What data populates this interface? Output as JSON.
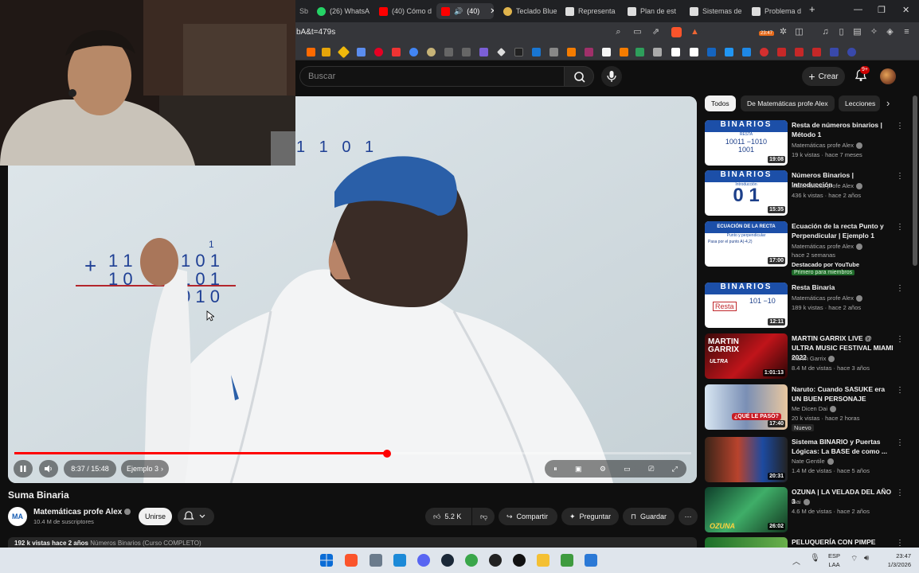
{
  "browser": {
    "tabs": [
      {
        "label": "(26) WhatsA",
        "icon": "whatsapp-icon",
        "color": "#25d366"
      },
      {
        "label": "(40) Cómo d",
        "icon": "youtube-icon",
        "color": "#ff0000"
      },
      {
        "label": "(40)",
        "icon": "youtube-icon",
        "color": "#ff0000",
        "active": true
      },
      {
        "label": "Teclado Blue",
        "icon": "tab-icon",
        "color": "#e0b44c"
      },
      {
        "label": "Representa",
        "icon": "tab-icon",
        "color": "#cccccc"
      },
      {
        "label": "Plan de est",
        "icon": "tab-icon",
        "color": "#cccccc"
      },
      {
        "label": "Sistemas de",
        "icon": "tab-icon",
        "color": "#cccccc"
      },
      {
        "label": "Problema d",
        "icon": "tab-icon",
        "color": "#cccccc"
      }
    ],
    "url": "bA&t=479s",
    "badge_time": "23:47"
  },
  "youtube": {
    "search_placeholder": "Buscar",
    "create_label": "Crear",
    "notif_count": "9+"
  },
  "video": {
    "overlay_text": "1 1 0 1",
    "current_time": "8:37",
    "duration": "15:48",
    "time_sep": " / ",
    "chapter": "Ejemplo 3",
    "progress": 0.55,
    "title": "Suma Binaria",
    "channel": "Matemáticas profe Alex",
    "channel_initials": "MA",
    "subscribers": "10.4 M de suscriptores",
    "join_label": "Unirse",
    "likes": "5.2 K",
    "share_label": "Compartir",
    "ask_label": "Preguntar",
    "save_label": "Guardar",
    "views": "192 k vistas",
    "age": "hace 2 años",
    "playlist": "Números Binarios (Curso COMPLETO)"
  },
  "sidebar": {
    "chips": [
      "Todos",
      "De Matemáticas profe Alex",
      "Lecciones"
    ],
    "items": [
      {
        "title": "Resta de números binarios | Método 1",
        "channel": "Matemáticas profe Alex",
        "meta": "19 k vistas · hace 7 meses",
        "duration": "19:08",
        "thumb_head": "BINARIOS",
        "thumb_sub": "RESTA",
        "thumb_body": "10011 −1010 1001"
      },
      {
        "title": "Números Binarios | Introducción",
        "channel": "Matemáticas profe Alex",
        "meta": "436 k vistas · hace 2 años",
        "duration": "15:35",
        "thumb_head": "BINARIOS",
        "thumb_sub": "Introducción",
        "thumb_body": "0 1"
      },
      {
        "title": "Ecuación de la recta Punto y Perpendicular | Ejemplo 1",
        "channel": "Matemáticas profe Alex",
        "meta": "hace 2 semanas",
        "extra1": "Destacado por YouTube",
        "extra2": "Primero para miembros",
        "duration": "17:00",
        "thumb_head": "ECUACIÓN DE LA RECTA",
        "thumb_sub": "Punto y perpendicular",
        "thumb_body": "Pasa por el punto A(-4,2)"
      },
      {
        "title": "Resta Binaria",
        "channel": "Matemáticas profe Alex",
        "meta": "189 k vistas · hace 2 años",
        "duration": "12:11",
        "thumb_head": "BINARIOS",
        "thumb_sub": "Resta",
        "thumb_body": "101 −10"
      },
      {
        "title": "MARTIN GARRIX LIVE @ ULTRA MUSIC FESTIVAL MIAMI 2022",
        "channel": "Martin Garrix",
        "meta": "8.4 M de vistas · hace 3 años",
        "duration": "1:01:13",
        "thumb_head": "MARTIN GARRIX",
        "thumb_sub": "ULTRA"
      },
      {
        "title": "Naruto: Cuando SASUKE era UN BUEN PERSONAJE",
        "channel": "Me Dicen Dai",
        "meta": "20 k vistas · hace 2 horas",
        "badge": "Nuevo",
        "duration": "17:40",
        "thumb_sub": "¿QUÉ LE PASÓ?"
      },
      {
        "title": "Sistema BINARIO y Puertas Lógicas: La BASE de como ...",
        "channel": "Nate Gentile",
        "meta": "1.4 M de vistas · hace 5 años",
        "duration": "20:31"
      },
      {
        "title": "OZUNA | LA VELADA DEL AÑO 3",
        "channel": "ibai",
        "meta": "4.6 M de vistas · hace 2 años",
        "duration": "26:02",
        "thumb_sub": "OZUNA"
      },
      {
        "title": "PELUQUERÍA CON PIMPE"
      }
    ]
  },
  "taskbar": {
    "lang": "ESP",
    "lang2": "LAA",
    "time": "23:47",
    "date": "1/3/2026"
  }
}
